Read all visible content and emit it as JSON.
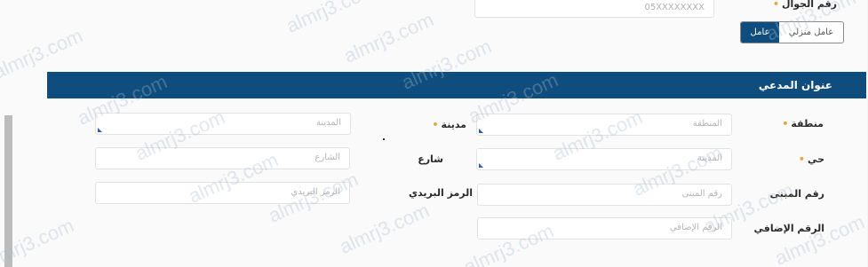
{
  "top": {
    "mobile_label": "رقم الجوال",
    "mobile_value": "05XXXXXXXX"
  },
  "toggle": {
    "active_label": "عامل",
    "other_label": "عامل منزلي"
  },
  "section": {
    "title": "عنوان المدعي"
  },
  "fields": {
    "region": {
      "label": "منطقة",
      "placeholder": "المنطقة"
    },
    "city": {
      "label": "مدينة",
      "placeholder": "المدينة"
    },
    "district": {
      "label": "حي",
      "placeholder": "المدينة"
    },
    "street": {
      "label": "شارع",
      "placeholder": "الشارع"
    },
    "building": {
      "label": "رقم المبنى",
      "placeholder": "رقم المبنى"
    },
    "postal": {
      "label": "الرمز البريدي",
      "placeholder": "الرمز البريدي"
    },
    "additional": {
      "label": "الرقم الإضافي",
      "placeholder": "الرقم الإضافي"
    }
  },
  "watermark": "almrj3.com",
  "colors": {
    "accent": "#0e4d7d",
    "required": "#e8a23a",
    "select_arrow": "#2d5ea8"
  }
}
